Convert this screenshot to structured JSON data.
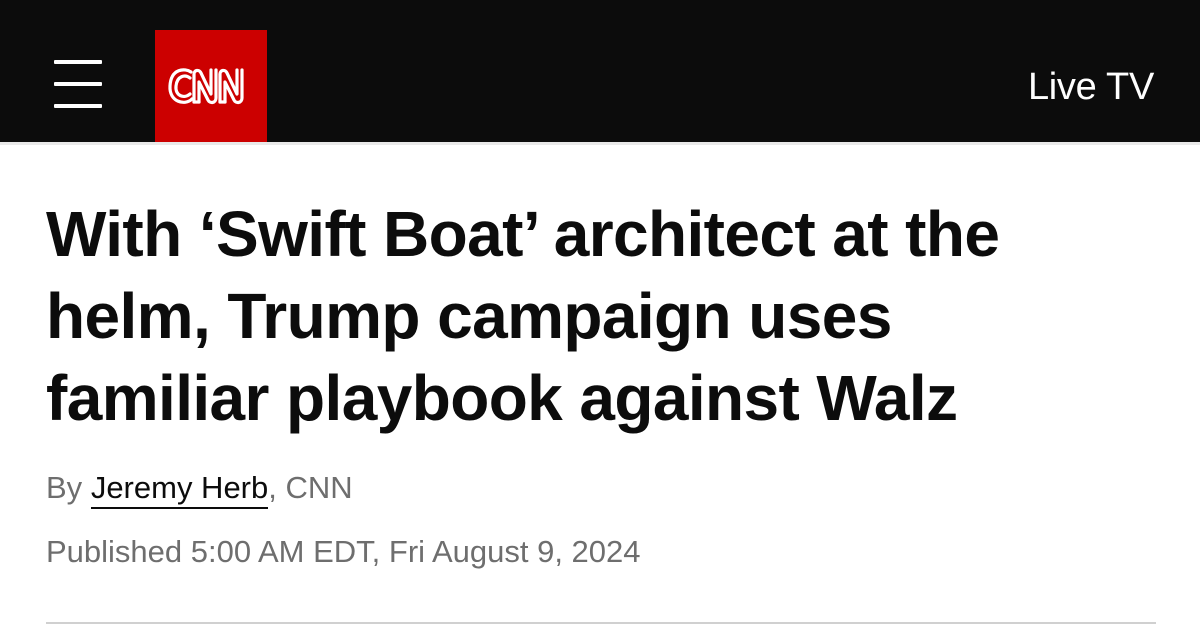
{
  "header": {
    "menu_icon": "hamburger-menu-icon",
    "logo_text": "CNN",
    "logo_bg_color": "#cc0000",
    "bar_color": "#0c0c0c",
    "live_tv_label": "Live TV"
  },
  "article": {
    "headline_lines": [
      "With ‘Swift Boat’ architect at the",
      "helm, Trump campaign uses",
      "familiar playbook against Walz"
    ],
    "byline_prefix": "By",
    "author": "Jeremy Herb",
    "byline_suffix": ", CNN",
    "published": "Published 5:00 AM EDT, Fri August 9, 2024"
  }
}
